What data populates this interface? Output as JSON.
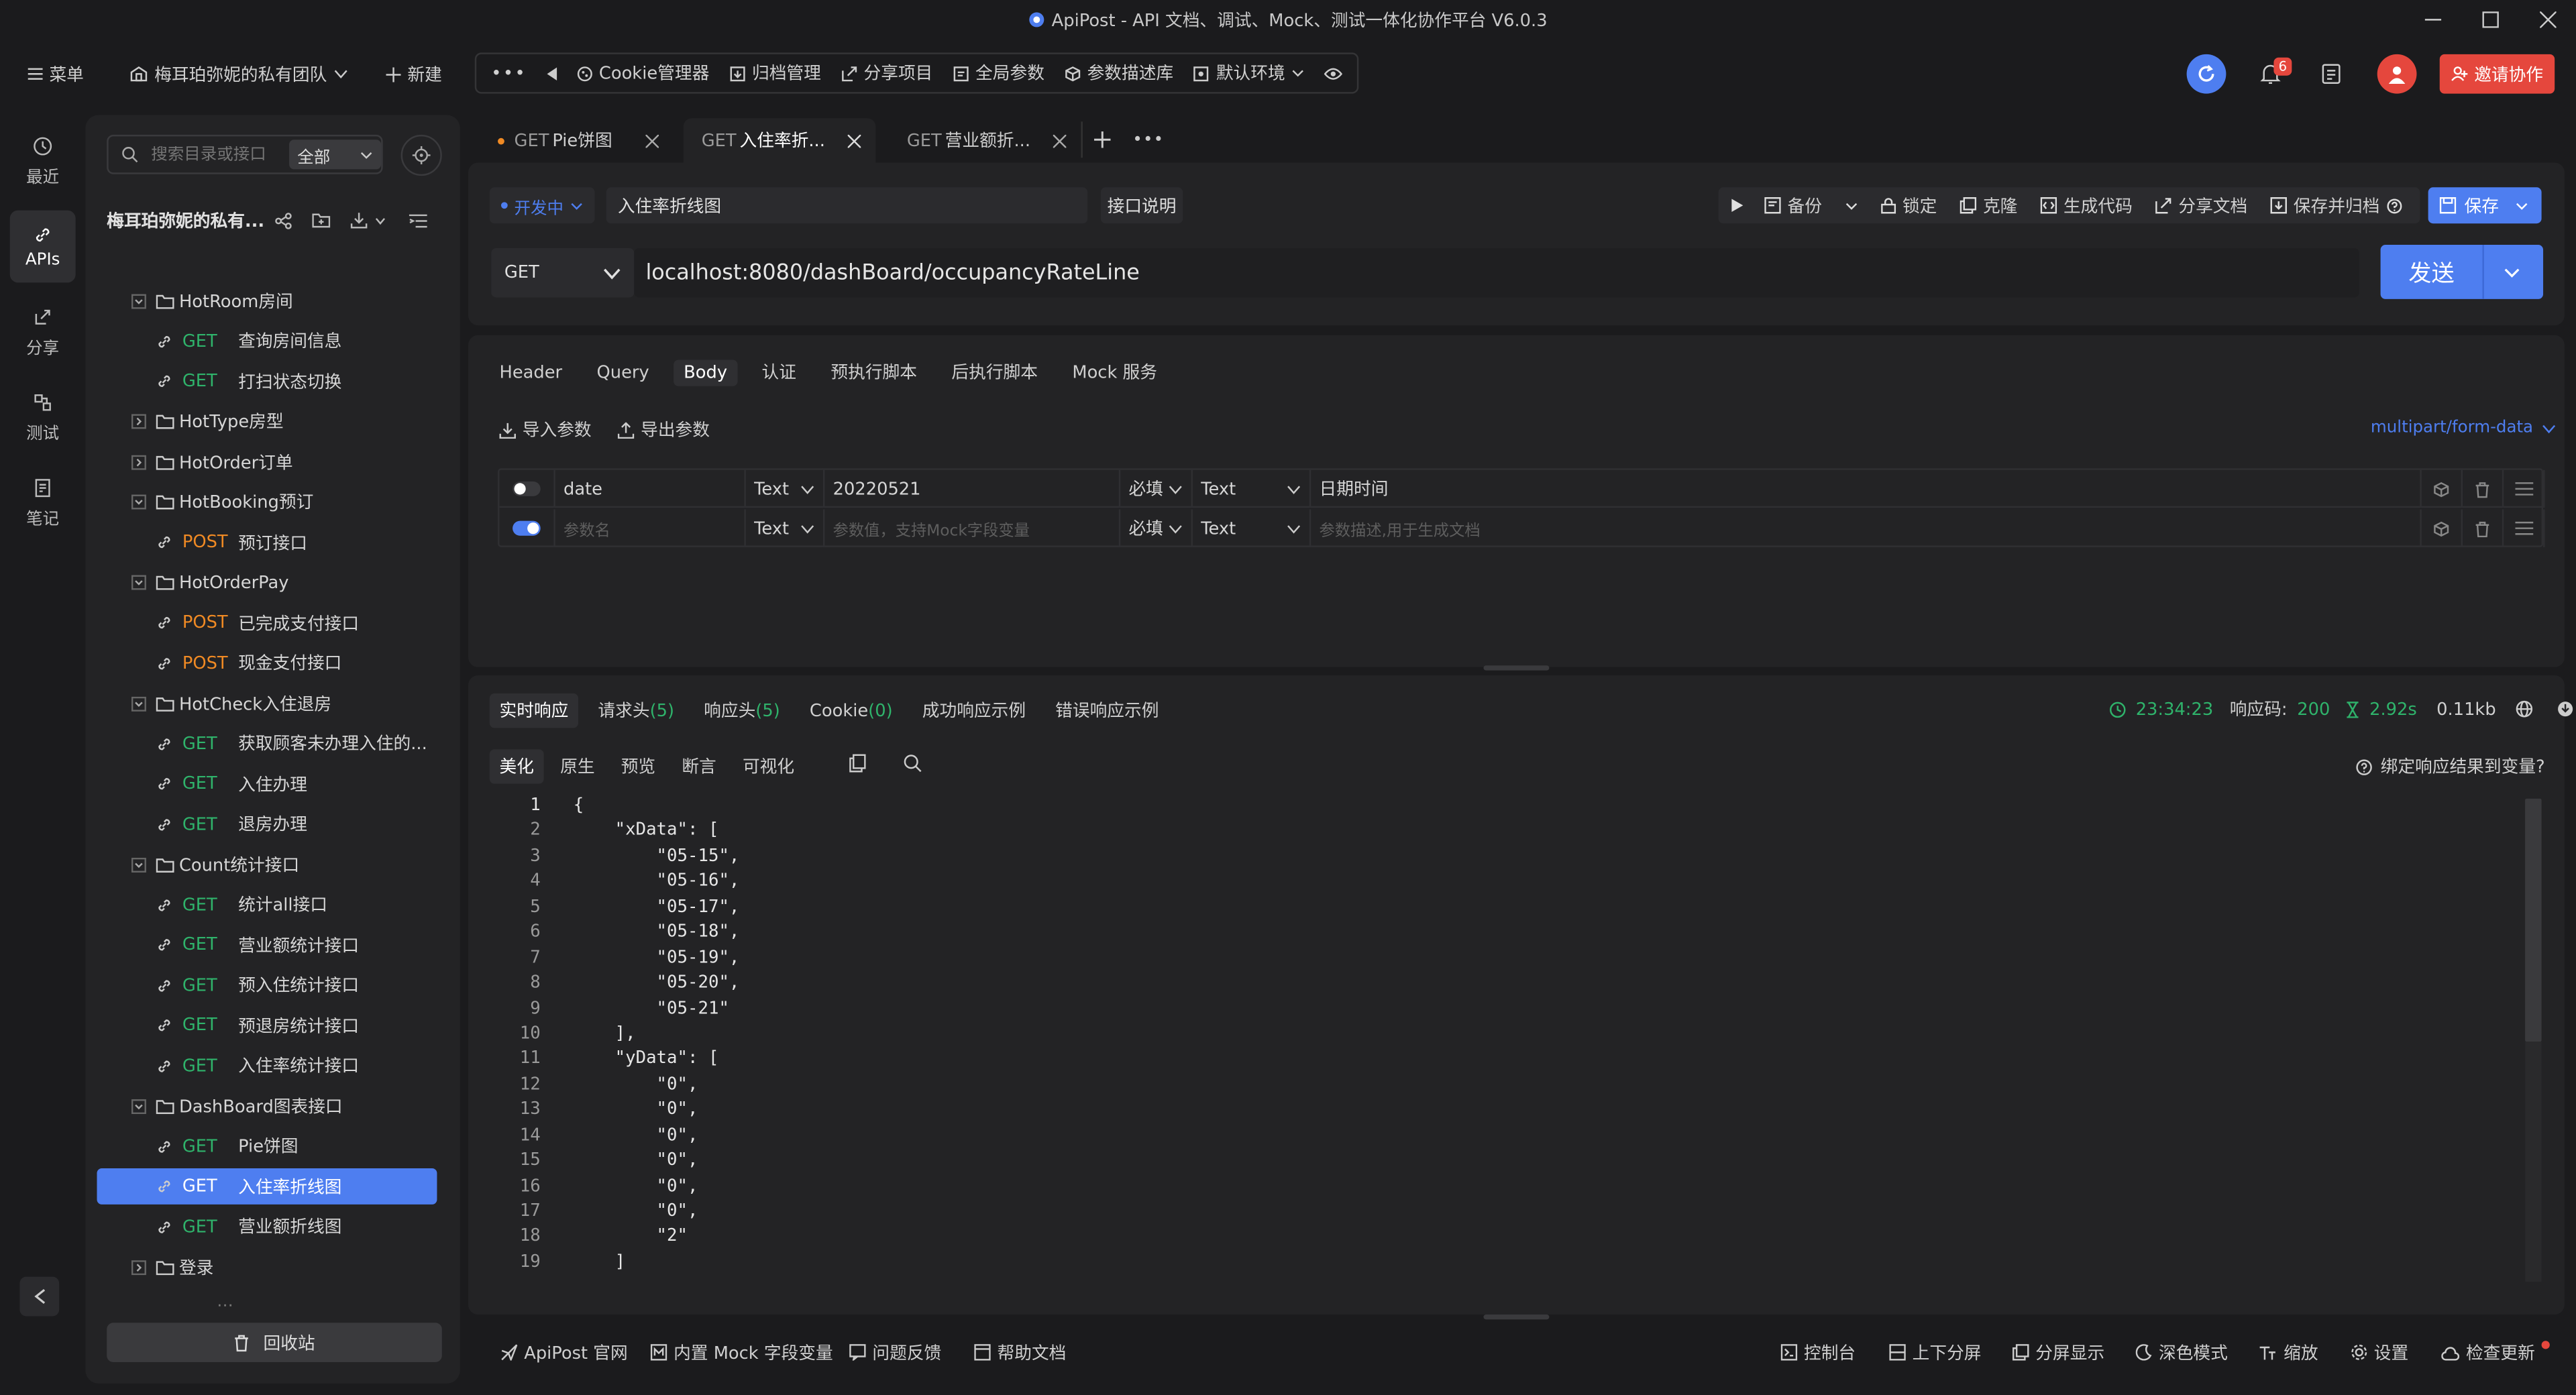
{
  "window": {
    "title": "ApiPost - API 文档、调试、Mock、测试一体化协作平台 V6.0.3"
  },
  "toolbar": {
    "menu_label": "菜单",
    "team_label": "梅耳珀弥妮的私有团队",
    "new_label": "新建",
    "cookie_label": "Cookie管理器",
    "archive_label": "归档管理",
    "share_project_label": "分享项目",
    "global_params_label": "全局参数",
    "param_desc_label": "参数描述库",
    "env_label": "默认环境",
    "notif_count": "6",
    "invite_label": "邀请协作"
  },
  "rail": {
    "recent": "最近",
    "apis": "APIs",
    "share": "分享",
    "test": "测试",
    "notes": "笔记"
  },
  "tree": {
    "search_placeholder": "搜索目录或接口",
    "filter": "全部",
    "project_title": "梅耳珀弥妮的私有...",
    "recycle_label": "回收站",
    "partial_label": "..."
  },
  "tree_items": [
    {
      "kind": "folder",
      "open": true,
      "label": "HotRoom房间"
    },
    {
      "kind": "api",
      "method": "GET",
      "label": "查询房间信息"
    },
    {
      "kind": "api",
      "method": "GET",
      "label": "打扫状态切换"
    },
    {
      "kind": "folder",
      "open": false,
      "label": "HotType房型"
    },
    {
      "kind": "folder",
      "open": false,
      "label": "HotOrder订单"
    },
    {
      "kind": "folder",
      "open": true,
      "label": "HotBooking预订"
    },
    {
      "kind": "api",
      "method": "POST",
      "label": "预订接口"
    },
    {
      "kind": "folder",
      "open": true,
      "label": "HotOrderPay"
    },
    {
      "kind": "api",
      "method": "POST",
      "label": "已完成支付接口"
    },
    {
      "kind": "api",
      "method": "POST",
      "label": "现金支付接口"
    },
    {
      "kind": "folder",
      "open": true,
      "label": "HotCheck入住退房"
    },
    {
      "kind": "api",
      "method": "GET",
      "label": "获取顾客未办理入住的..."
    },
    {
      "kind": "api",
      "method": "GET",
      "label": "入住办理"
    },
    {
      "kind": "api",
      "method": "GET",
      "label": "退房办理"
    },
    {
      "kind": "folder",
      "open": true,
      "label": "Count统计接口"
    },
    {
      "kind": "api",
      "method": "GET",
      "label": "统计all接口"
    },
    {
      "kind": "api",
      "method": "GET",
      "label": "营业额统计接口"
    },
    {
      "kind": "api",
      "method": "GET",
      "label": "预入住统计接口"
    },
    {
      "kind": "api",
      "method": "GET",
      "label": "预退房统计接口"
    },
    {
      "kind": "api",
      "method": "GET",
      "label": "入住率统计接口"
    },
    {
      "kind": "folder",
      "open": true,
      "label": "DashBoard图表接口"
    },
    {
      "kind": "api",
      "method": "GET",
      "label": "Pie饼图"
    },
    {
      "kind": "api",
      "method": "GET",
      "label": "入住率折线图",
      "selected": true
    },
    {
      "kind": "api",
      "method": "GET",
      "label": "营业额折线图"
    },
    {
      "kind": "folder",
      "open": false,
      "label": "登录"
    }
  ],
  "tabs": [
    {
      "method": "GET",
      "label": "Pie饼图"
    },
    {
      "method": "GET",
      "label": "入住率折..."
    },
    {
      "method": "GET",
      "label": "营业额折..."
    }
  ],
  "request": {
    "status": "开发中",
    "name": "入住率折线图",
    "doc_label": "接口说明",
    "backup": "备份",
    "lock": "锁定",
    "clone": "克隆",
    "gen_code": "生成代码",
    "share_doc": "分享文档",
    "save_archive": "保存并归档",
    "save": "保存",
    "method": "GET",
    "url": "localhost:8080/dashBoard/occupancyRateLine",
    "send": "发送"
  },
  "param_tabs": [
    "Header",
    "Query",
    "Body",
    "认证",
    "预执行脚本",
    "后执行脚本",
    "Mock 服务"
  ],
  "body": {
    "import_label": "导入参数",
    "export_label": "导出参数",
    "content_type": "multipart/form-data",
    "rows": [
      {
        "name": "date",
        "type": "Text",
        "value": "20220521",
        "required": "必填",
        "vtype": "Text",
        "desc": "日期时间"
      },
      {
        "name": "参数名",
        "type": "Text",
        "value": "参数值，支持Mock字段变量",
        "required": "必填",
        "vtype": "Text",
        "desc": "参数描述,用于生成文档"
      }
    ]
  },
  "response": {
    "tabs": {
      "live": "实时响应",
      "req_headers": "请求头",
      "req_headers_count": "5",
      "resp_headers": "响应头",
      "resp_headers_count": "5",
      "cookie": "Cookie",
      "cookie_count": "0",
      "success_example": "成功响应示例",
      "error_example": "错误响应示例"
    },
    "time": "23:34:23",
    "code_label": "响应码:",
    "code": "200",
    "duration": "2.92s",
    "size": "0.11kb",
    "view_tabs": [
      "美化",
      "原生",
      "预览",
      "断言",
      "可视化"
    ],
    "bind_label": "绑定响应结果到变量?",
    "lines": [
      "{",
      "    \"xData\": [",
      "        \"05-15\",",
      "        \"05-16\",",
      "        \"05-17\",",
      "        \"05-18\",",
      "        \"05-19\",",
      "        \"05-20\",",
      "        \"05-21\"",
      "    ],",
      "    \"yData\": [",
      "        \"0\",",
      "        \"0\",",
      "        \"0\",",
      "        \"0\",",
      "        \"0\",",
      "        \"0\",",
      "        \"2\"",
      "    ]"
    ]
  },
  "footer": {
    "official": "ApiPost 官网",
    "mock_vars": "内置 Mock 字段变量",
    "feedback": "问题反馈",
    "help": "帮助文档",
    "console": "控制台",
    "split_v": "上下分屏",
    "split_show": "分屏显示",
    "dark": "深色模式",
    "zoom": "缩放",
    "settings": "设置",
    "update": "检查更新"
  },
  "colors": {
    "accent": "#4e7ef0",
    "get": "#2fb36b",
    "post": "#f08a24",
    "danger": "#e5473d"
  }
}
